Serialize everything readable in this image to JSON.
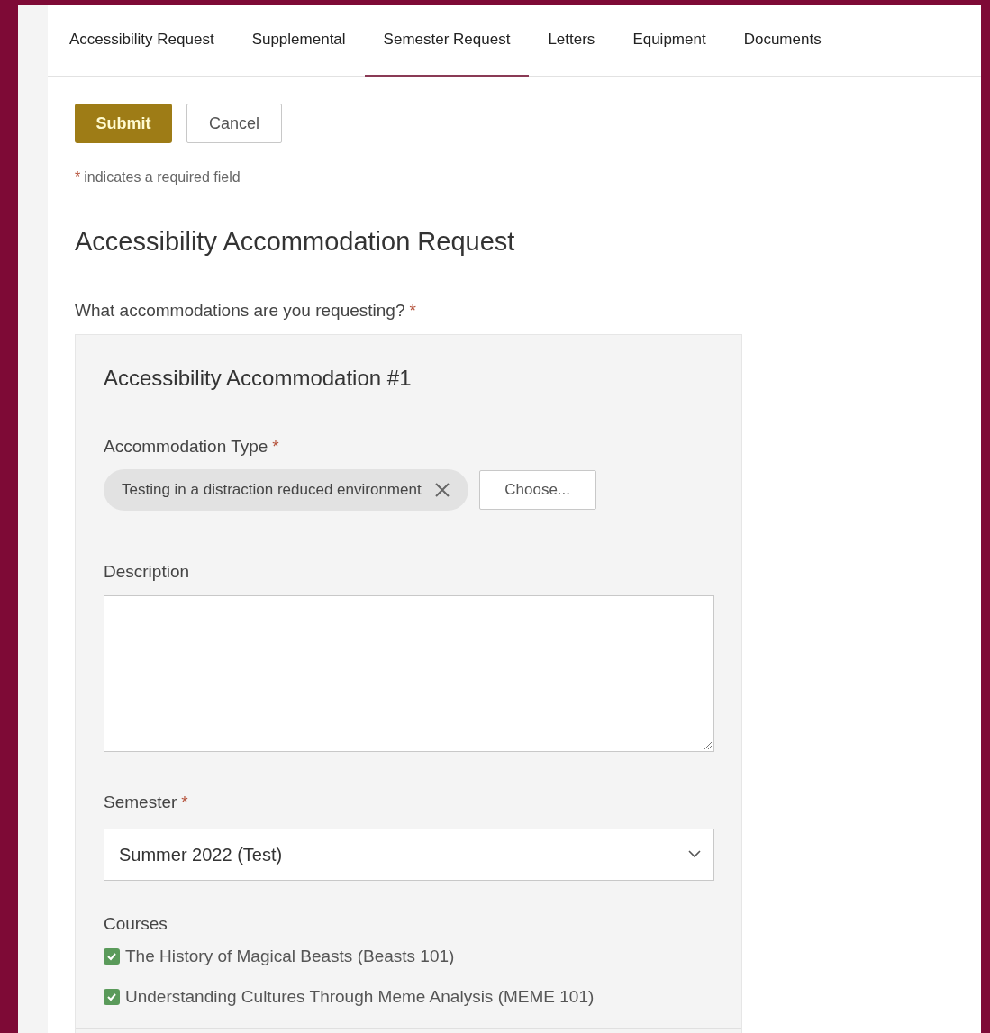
{
  "tabs": [
    {
      "label": "Accessibility Request",
      "selected": false
    },
    {
      "label": "Supplemental",
      "selected": false
    },
    {
      "label": "Semester Request",
      "selected": true
    },
    {
      "label": "Letters",
      "selected": false
    },
    {
      "label": "Equipment",
      "selected": false
    },
    {
      "label": "Documents",
      "selected": false
    }
  ],
  "actions": {
    "submit": "Submit",
    "cancel": "Cancel"
  },
  "required_note": {
    "mark": "*",
    "text": "indicates a required field"
  },
  "form_title": "Accessibility Accommodation Request",
  "question": {
    "label": "What accommodations are you requesting?",
    "mark": "*"
  },
  "accommodation": {
    "heading": "Accessibility Accommodation #1",
    "type_label": "Accommodation Type",
    "type_mark": "*",
    "chip": "Testing in a distraction reduced environment",
    "choose": "Choose...",
    "description_label": "Description",
    "semester_label": "Semester",
    "semester_mark": "*",
    "semester_value": "Summer 2022 (Test)",
    "courses_label": "Courses",
    "courses": [
      {
        "label": "The History of Magical Beasts (Beasts 101)",
        "checked": true
      },
      {
        "label": "Understanding Cultures Through Meme Analysis (MEME 101)",
        "checked": true
      }
    ]
  }
}
